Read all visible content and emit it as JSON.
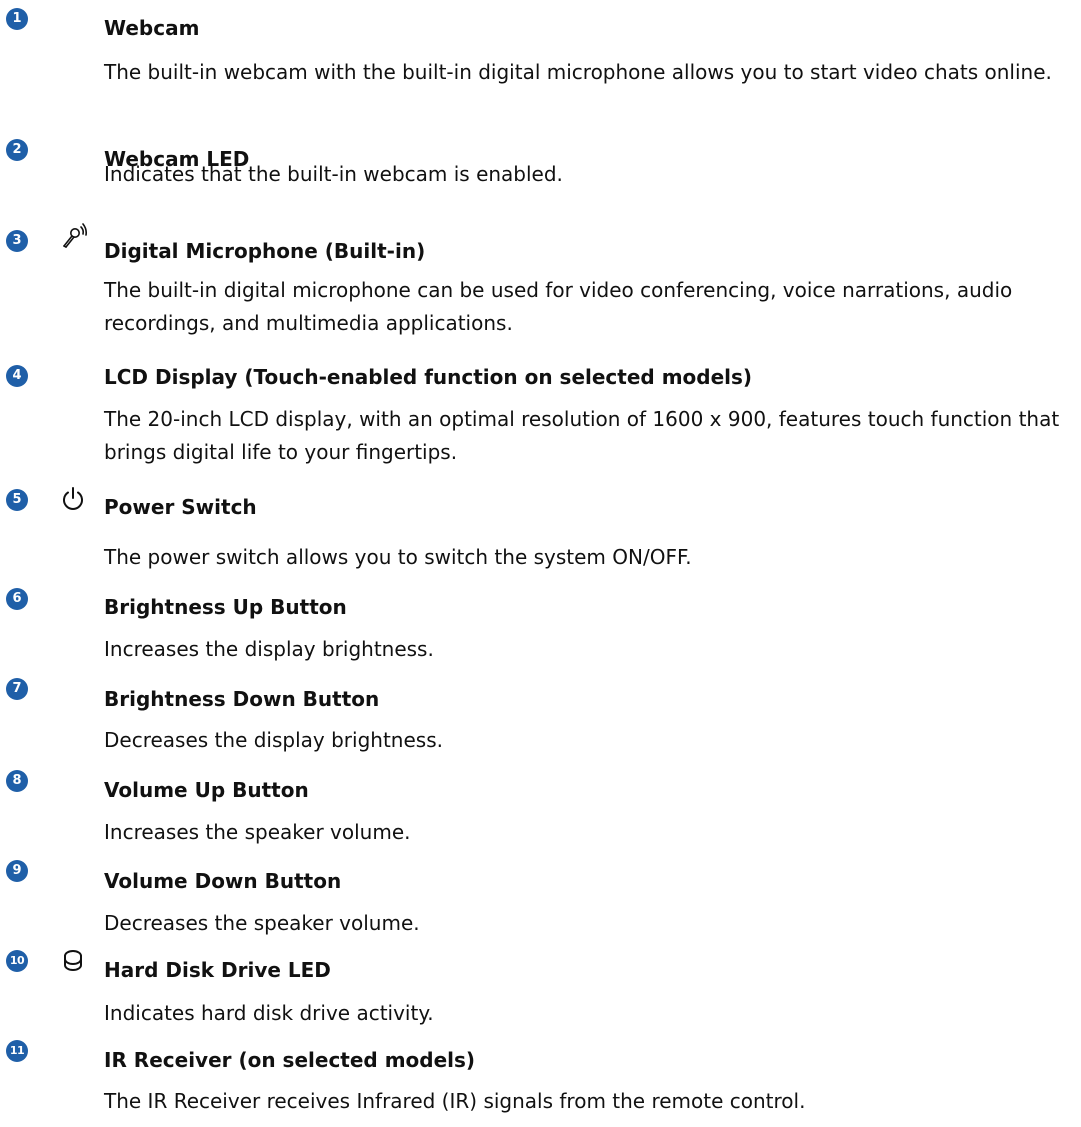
{
  "accent_color": "#1f5fa8",
  "items": [
    {
      "number": "1",
      "icon": "",
      "title": "Webcam",
      "description": "The built-in webcam with the built-in digital microphone allows you to start video chats online."
    },
    {
      "number": "2",
      "icon": "",
      "title": "Webcam LED",
      "description": "Indicates that the built-in webcam is enabled."
    },
    {
      "number": "3",
      "icon": "microphone-icon",
      "title": "Digital Microphone (Built-in)",
      "description": "The built-in digital microphone can be used for video conferencing, voice narrations, audio recordings, and multimedia applications."
    },
    {
      "number": "4",
      "icon": "",
      "title": "LCD Display (Touch-enabled function on selected models)",
      "description": "The 20-inch LCD display, with an optimal resolution of 1600 x 900, features touch function that brings digital life to your fingertips."
    },
    {
      "number": "5",
      "icon": "power-icon",
      "title": "Power Switch",
      "description": "The power switch allows you to switch the system ON/OFF."
    },
    {
      "number": "6",
      "icon": "",
      "title": "Brightness Up Button",
      "description": "Increases the display brightness."
    },
    {
      "number": "7",
      "icon": "",
      "title": "Brightness Down Button",
      "description": "Decreases the display brightness."
    },
    {
      "number": "8",
      "icon": "",
      "title": "Volume Up Button",
      "description": "Increases the speaker volume."
    },
    {
      "number": "9",
      "icon": "",
      "title": "Volume Down Button",
      "description": "Decreases the speaker volume."
    },
    {
      "number": "10",
      "icon": "hard-disk-icon",
      "title": "Hard Disk Drive LED",
      "description": "Indicates hard disk drive activity."
    },
    {
      "number": "11",
      "icon": "",
      "title": "IR Receiver (on selected models)",
      "description": "The IR Receiver receives Infrared (IR) signals from the remote control."
    }
  ]
}
